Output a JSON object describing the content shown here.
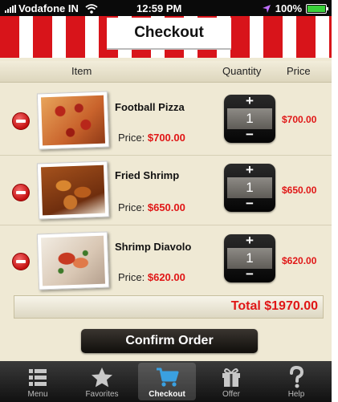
{
  "status_bar": {
    "carrier": "Vodafone IN",
    "time": "12:59 PM",
    "battery": "100%",
    "battery_level": 1.0
  },
  "header": {
    "title": "Checkout"
  },
  "columns": {
    "item": "Item",
    "quantity": "Quantity",
    "price": "Price"
  },
  "items": [
    {
      "name": "Football Pizza",
      "price_label": "Price:",
      "price": "$700.00",
      "quantity": "1",
      "line_total": "$700.00",
      "image": "pizza-photo"
    },
    {
      "name": "Fried Shrimp",
      "price_label": "Price:",
      "price": "$650.00",
      "quantity": "1",
      "line_total": "$650.00",
      "image": "fried-shrimp-photo"
    },
    {
      "name": "Shrimp Diavolo",
      "price_label": "Price:",
      "price": "$620.00",
      "quantity": "1",
      "line_total": "$620.00",
      "image": "shrimp-diavolo-photo"
    }
  ],
  "stepper": {
    "plus": "+",
    "minus": "−"
  },
  "total": "Total $1970.00",
  "confirm_button": "Confirm Order",
  "tabs": [
    {
      "label": "Menu",
      "icon": "list-icon",
      "active": false
    },
    {
      "label": "Favorites",
      "icon": "star-icon",
      "active": false
    },
    {
      "label": "Checkout",
      "icon": "cart-icon",
      "active": true
    },
    {
      "label": "Offer",
      "icon": "gift-icon",
      "active": false
    },
    {
      "label": "Help",
      "icon": "question-icon",
      "active": false
    }
  ],
  "colors": {
    "accent_red": "#e01616",
    "awning_red": "#d8141a",
    "background": "#efe9d4",
    "tab_active": "#3aa0e0"
  }
}
